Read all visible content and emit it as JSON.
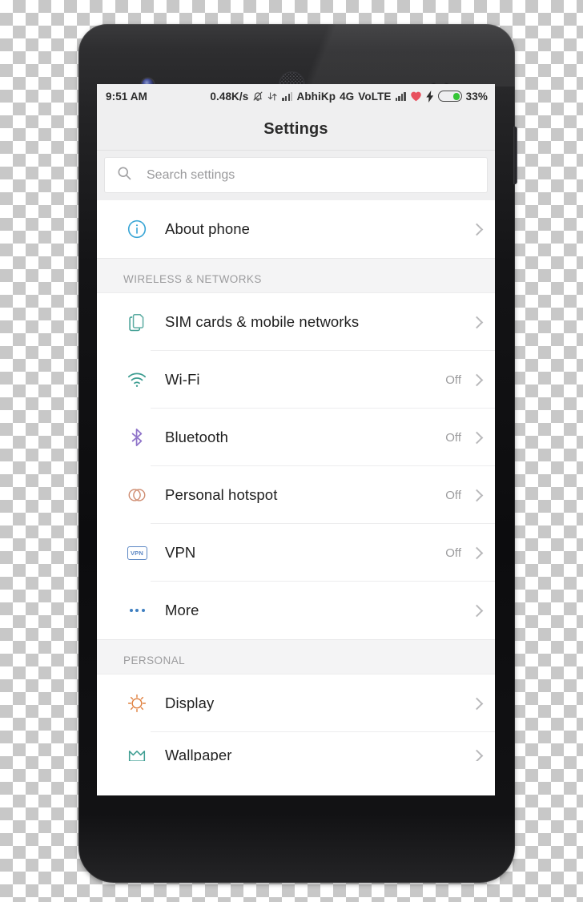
{
  "status_bar": {
    "time": "9:51 AM",
    "network_speed": "0.48K/s",
    "icons": [
      "silent-bell-icon",
      "data-transfer-icon",
      "signal-bars-icon"
    ],
    "carrier": "AbhiKp",
    "network_type": "4G",
    "volte": "VoLTE",
    "heart_icon": "heart-icon",
    "charging_icon": "lightning-bolt-icon",
    "battery_percent": "33%",
    "battery_level": 33
  },
  "header": {
    "title": "Settings"
  },
  "search": {
    "placeholder": "Search settings",
    "value": "",
    "icon": "search-icon"
  },
  "sections": [
    {
      "header": "",
      "items": [
        {
          "icon": "info-circle-icon",
          "label": "About phone",
          "value": "",
          "color": "#3aa6d6"
        }
      ]
    },
    {
      "header": "WIRELESS & NETWORKS",
      "items": [
        {
          "icon": "sim-cards-icon",
          "label": "SIM cards & mobile networks",
          "value": "",
          "color": "#3f9e92"
        },
        {
          "icon": "wifi-icon",
          "label": "Wi-Fi",
          "value": "Off",
          "color": "#3f9e92"
        },
        {
          "icon": "bluetooth-icon",
          "label": "Bluetooth",
          "value": "Off",
          "color": "#8f74c9"
        },
        {
          "icon": "hotspot-icon",
          "label": "Personal hotspot",
          "value": "Off",
          "color": "#cf8d72"
        },
        {
          "icon": "vpn-icon",
          "label": "VPN",
          "value": "Off",
          "color": "#5c87c4"
        },
        {
          "icon": "more-dots-icon",
          "label": "More",
          "value": "",
          "color": "#3f7fc1"
        }
      ]
    },
    {
      "header": "PERSONAL",
      "items": [
        {
          "icon": "display-sun-icon",
          "label": "Display",
          "value": "",
          "color": "#e0803f"
        },
        {
          "icon": "wallpaper-icon",
          "label": "Wallpaper",
          "value": "",
          "color": "#3f9e92"
        }
      ]
    }
  ],
  "device": {
    "camera": "front-camera",
    "earpiece": "earpiece-speaker",
    "power_button": "power-button"
  },
  "colors": {
    "status_bar_bg": "#efeff0",
    "screen_bg": "#ffffff",
    "section_header_bg": "#f4f4f5",
    "battery_green": "#35c536",
    "heart_red": "#e8505e"
  }
}
